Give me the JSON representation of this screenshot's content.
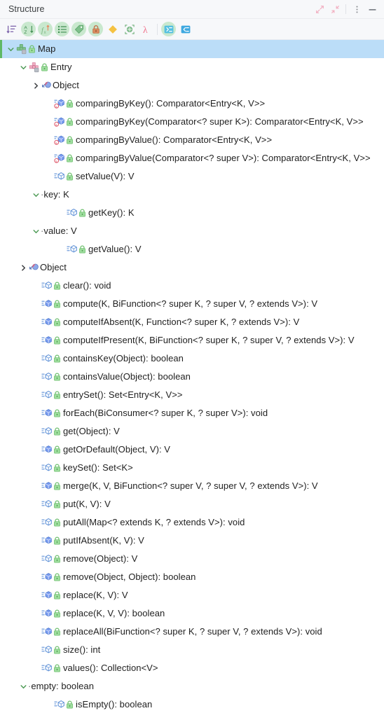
{
  "window": {
    "title": "Structure",
    "buttons": [
      {
        "name": "expand-window-button",
        "label": "Expand"
      },
      {
        "name": "collapse-window-button",
        "label": "Shrink"
      },
      {
        "name": "options-menu-button",
        "label": "Options"
      },
      {
        "name": "hide-button",
        "label": "Hide"
      }
    ]
  },
  "toolbar": {
    "items": [
      {
        "name": "sort-by-visibility-button",
        "icon": "sort-by-visibility-icon",
        "label": "Sort by Visibility",
        "active": false
      },
      {
        "name": "sort-alphabetically-button",
        "icon": "sort-alphabetically-icon",
        "label": "Sort Alphabetically",
        "active": true
      },
      {
        "name": "show-fields-button",
        "icon": "show-fields-icon",
        "label": "Show Fields",
        "active": true
      },
      {
        "name": "show-properties-button",
        "icon": "show-properties-icon",
        "label": "Show Properties",
        "active": true
      },
      {
        "name": "group-by-property-button",
        "icon": "tag-icon",
        "label": "Group Methods by Property",
        "active": true
      },
      {
        "name": "show-non-public-button",
        "icon": "lock-icon",
        "label": "Show Non-Public",
        "active": true
      },
      {
        "name": "show-inherited-button",
        "icon": "diamond-icon",
        "label": "Show Inherited",
        "active": false
      },
      {
        "name": "show-anonymous-classes-button",
        "icon": "anonymous-class-icon",
        "label": "Show Anonymous Classes",
        "active": false
      },
      {
        "name": "show-lambdas-button",
        "icon": "lambda-icon",
        "label": "Show Lambdas",
        "active": false
      },
      {
        "name": "expand-all-button",
        "icon": "expand-all-icon",
        "label": "Expand All",
        "active": true
      },
      {
        "name": "collapse-all-button",
        "icon": "collapse-all-icon",
        "label": "Collapse All",
        "active": false
      }
    ]
  },
  "tree": {
    "rows": [
      {
        "text": "Map",
        "depth": 0,
        "twisty": "expanded",
        "icon": "interface-icon",
        "lock": true,
        "selected": true
      },
      {
        "text": "Entry",
        "depth": 1,
        "twisty": "expanded",
        "icon": "interface-nested-icon",
        "lock": true,
        "selected": false
      },
      {
        "text": "Object",
        "depth": 2,
        "twisty": "collapsed",
        "icon": "class-inherited-icon",
        "lock": false,
        "selected": false
      },
      {
        "text": "comparingByKey(): Comparator<Entry<K, V>>",
        "depth": 3,
        "twisty": "none",
        "icon": "method-static-icon",
        "lock": true,
        "selected": false
      },
      {
        "text": "comparingByKey(Comparator<? super K>): Comparator<Entry<K, V>>",
        "depth": 3,
        "twisty": "none",
        "icon": "method-static-icon",
        "lock": true,
        "selected": false
      },
      {
        "text": "comparingByValue(): Comparator<Entry<K, V>>",
        "depth": 3,
        "twisty": "none",
        "icon": "method-static-icon",
        "lock": true,
        "selected": false
      },
      {
        "text": "comparingByValue(Comparator<? super V>): Comparator<Entry<K, V>>",
        "depth": 3,
        "twisty": "none",
        "icon": "method-static-icon",
        "lock": true,
        "selected": false
      },
      {
        "text": "setValue(V): V",
        "depth": 3,
        "twisty": "none",
        "icon": "method-abstract-icon",
        "lock": true,
        "selected": false
      },
      {
        "text": "key: K",
        "depth": 2,
        "twisty": "expanded",
        "icon": "none",
        "lock": false,
        "selected": false,
        "property": true
      },
      {
        "text": "getKey(): K",
        "depth": 4,
        "twisty": "none",
        "icon": "method-abstract-icon",
        "lock": true,
        "selected": false
      },
      {
        "text": "value: V",
        "depth": 2,
        "twisty": "expanded",
        "icon": "none",
        "lock": false,
        "selected": false,
        "property": true
      },
      {
        "text": "getValue(): V",
        "depth": 4,
        "twisty": "none",
        "icon": "method-abstract-icon",
        "lock": true,
        "selected": false
      },
      {
        "text": "Object",
        "depth": 1,
        "twisty": "collapsed",
        "icon": "class-inherited-icon",
        "lock": false,
        "selected": false
      },
      {
        "text": "clear(): void",
        "depth": 2,
        "twisty": "none",
        "icon": "method-abstract-icon",
        "lock": true,
        "selected": false
      },
      {
        "text": "compute(K, BiFunction<? super K, ? super V, ? extends V>): V",
        "depth": 2,
        "twisty": "none",
        "icon": "method-default-icon",
        "lock": true,
        "selected": false
      },
      {
        "text": "computeIfAbsent(K, Function<? super K, ? extends V>): V",
        "depth": 2,
        "twisty": "none",
        "icon": "method-default-icon",
        "lock": true,
        "selected": false
      },
      {
        "text": "computeIfPresent(K, BiFunction<? super K, ? super V, ? extends V>): V",
        "depth": 2,
        "twisty": "none",
        "icon": "method-default-icon",
        "lock": true,
        "selected": false
      },
      {
        "text": "containsKey(Object): boolean",
        "depth": 2,
        "twisty": "none",
        "icon": "method-abstract-icon",
        "lock": true,
        "selected": false
      },
      {
        "text": "containsValue(Object): boolean",
        "depth": 2,
        "twisty": "none",
        "icon": "method-abstract-icon",
        "lock": true,
        "selected": false
      },
      {
        "text": "entrySet(): Set<Entry<K, V>>",
        "depth": 2,
        "twisty": "none",
        "icon": "method-abstract-icon",
        "lock": true,
        "selected": false
      },
      {
        "text": "forEach(BiConsumer<? super K, ? super V>): void",
        "depth": 2,
        "twisty": "none",
        "icon": "method-default-icon",
        "lock": true,
        "selected": false
      },
      {
        "text": "get(Object): V",
        "depth": 2,
        "twisty": "none",
        "icon": "method-abstract-icon",
        "lock": true,
        "selected": false
      },
      {
        "text": "getOrDefault(Object, V): V",
        "depth": 2,
        "twisty": "none",
        "icon": "method-default-icon",
        "lock": true,
        "selected": false
      },
      {
        "text": "keySet(): Set<K>",
        "depth": 2,
        "twisty": "none",
        "icon": "method-abstract-icon",
        "lock": true,
        "selected": false
      },
      {
        "text": "merge(K, V, BiFunction<? super V, ? super V, ? extends V>): V",
        "depth": 2,
        "twisty": "none",
        "icon": "method-default-icon",
        "lock": true,
        "selected": false
      },
      {
        "text": "put(K, V): V",
        "depth": 2,
        "twisty": "none",
        "icon": "method-abstract-icon",
        "lock": true,
        "selected": false
      },
      {
        "text": "putAll(Map<? extends K, ? extends V>): void",
        "depth": 2,
        "twisty": "none",
        "icon": "method-abstract-icon",
        "lock": true,
        "selected": false
      },
      {
        "text": "putIfAbsent(K, V): V",
        "depth": 2,
        "twisty": "none",
        "icon": "method-default-icon",
        "lock": true,
        "selected": false
      },
      {
        "text": "remove(Object): V",
        "depth": 2,
        "twisty": "none",
        "icon": "method-abstract-icon",
        "lock": true,
        "selected": false
      },
      {
        "text": "remove(Object, Object): boolean",
        "depth": 2,
        "twisty": "none",
        "icon": "method-default-icon",
        "lock": true,
        "selected": false
      },
      {
        "text": "replace(K, V): V",
        "depth": 2,
        "twisty": "none",
        "icon": "method-default-icon",
        "lock": true,
        "selected": false
      },
      {
        "text": "replace(K, V, V): boolean",
        "depth": 2,
        "twisty": "none",
        "icon": "method-default-icon",
        "lock": true,
        "selected": false
      },
      {
        "text": "replaceAll(BiFunction<? super K, ? super V, ? extends V>): void",
        "depth": 2,
        "twisty": "none",
        "icon": "method-default-icon",
        "lock": true,
        "selected": false
      },
      {
        "text": "size(): int",
        "depth": 2,
        "twisty": "none",
        "icon": "method-abstract-icon",
        "lock": true,
        "selected": false
      },
      {
        "text": "values(): Collection<V>",
        "depth": 2,
        "twisty": "none",
        "icon": "method-abstract-icon",
        "lock": true,
        "selected": false
      },
      {
        "text": "empty: boolean",
        "depth": 1,
        "twisty": "expanded",
        "icon": "none",
        "lock": false,
        "selected": false,
        "property": true
      },
      {
        "text": "isEmpty(): boolean",
        "depth": 3,
        "twisty": "none",
        "icon": "method-abstract-icon",
        "lock": true,
        "selected": false
      }
    ]
  },
  "colors": {
    "selection": "#BBDDF8",
    "selection_accent": "#5FB865",
    "toolbar_bg": "#F7F8FA",
    "text": "#1F1F1F",
    "interface_green": "#5FB865",
    "interface_pink": "#E58BA8",
    "method_blue": "#7A9CF0",
    "lock_green": "#7ED07E",
    "static_badge_red": "#E05C6E",
    "lambda_pink": "#F0728C",
    "diamond_yellow": "#F5C242"
  }
}
